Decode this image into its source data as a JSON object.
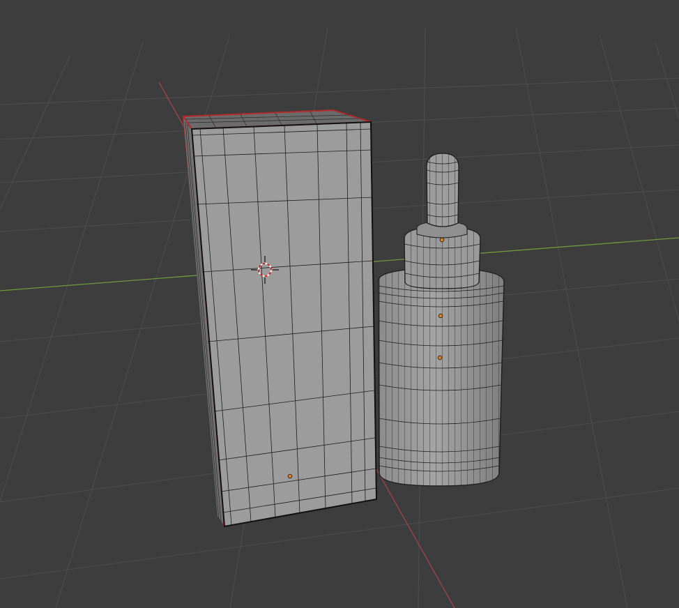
{
  "viewport": {
    "mode": "3d-viewport-wireframe-overlay",
    "background_color": "#3d3d3d",
    "grid_color": "#4d4d4d",
    "x_axis_color": "#a8434b",
    "y_axis_color": "#6f9a3c",
    "selection_outline_color": "#b52a2a",
    "origin_dot_color": "#e07f22"
  },
  "objects": [
    {
      "name": "box",
      "selected": true,
      "fill": "#999999"
    },
    {
      "name": "dropper-bottle",
      "selected": false,
      "fill": "#9a9a9a"
    }
  ],
  "cursor": {
    "icon": "3d-cursor-icon"
  }
}
